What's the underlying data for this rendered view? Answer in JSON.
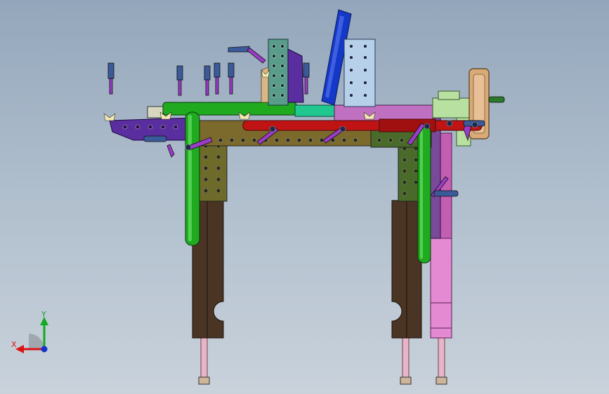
{
  "viewport": {
    "background_top": "#93a6bb",
    "background_bottom": "#c9d2db"
  },
  "model": {
    "description_icon": "welding-fixture-model",
    "colors": {
      "base_plate": "#7c6a2c",
      "green_tube": "#1faa1f",
      "red_tube": "#c01414",
      "blue_tube": "#1438c8",
      "purple_plate": "#5a2e9e",
      "magenta_plate": "#c070c0",
      "pink_leg": "#e48ad2",
      "brown_leg": "#4a3424",
      "teal_block": "#5a9c8c",
      "light_blue_block": "#b6d0ea",
      "tan_plate": "#d8aa78",
      "olive_column": "#6e6a2a",
      "clamp_purple": "#9a3cc8",
      "clamp_blue": "#3a5a9a"
    }
  },
  "triad": {
    "x_label": "X",
    "y_label": "Y",
    "x_color": "#dd1111",
    "y_color": "#11aa22",
    "z_color": "#1133cc"
  }
}
